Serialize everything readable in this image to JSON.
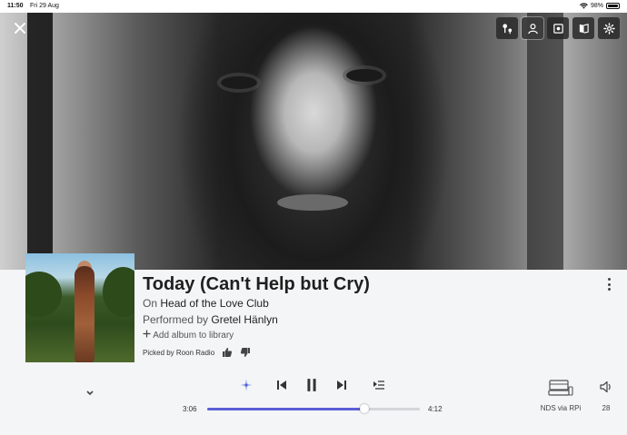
{
  "status_bar": {
    "time": "11:50",
    "date": "Fri 29 Aug",
    "battery": "98%",
    "battery_level": 0.98
  },
  "hero": {
    "close_icon": "close-icon",
    "tools": [
      {
        "name": "radio-icon"
      },
      {
        "name": "artist-icon",
        "active": true
      },
      {
        "name": "album-icon"
      },
      {
        "name": "lyrics-book-icon"
      },
      {
        "name": "settings-icon"
      }
    ]
  },
  "track": {
    "title": "Today (Can't Help but Cry)",
    "on_prefix": "On",
    "album": "Head of the Love Club",
    "performed_prefix": "Performed by",
    "artist": "Gretel Hänlyn",
    "add_label": "Add album to library",
    "picked_label": "Picked by Roon Radio"
  },
  "playback": {
    "elapsed": "3:06",
    "duration": "4:12",
    "progress": 0.738
  },
  "zone": {
    "label": "NDS via RPi"
  },
  "volume": {
    "value": "28"
  },
  "colors": {
    "accent": "#5b5fd6",
    "background": "#f4f5f7"
  }
}
